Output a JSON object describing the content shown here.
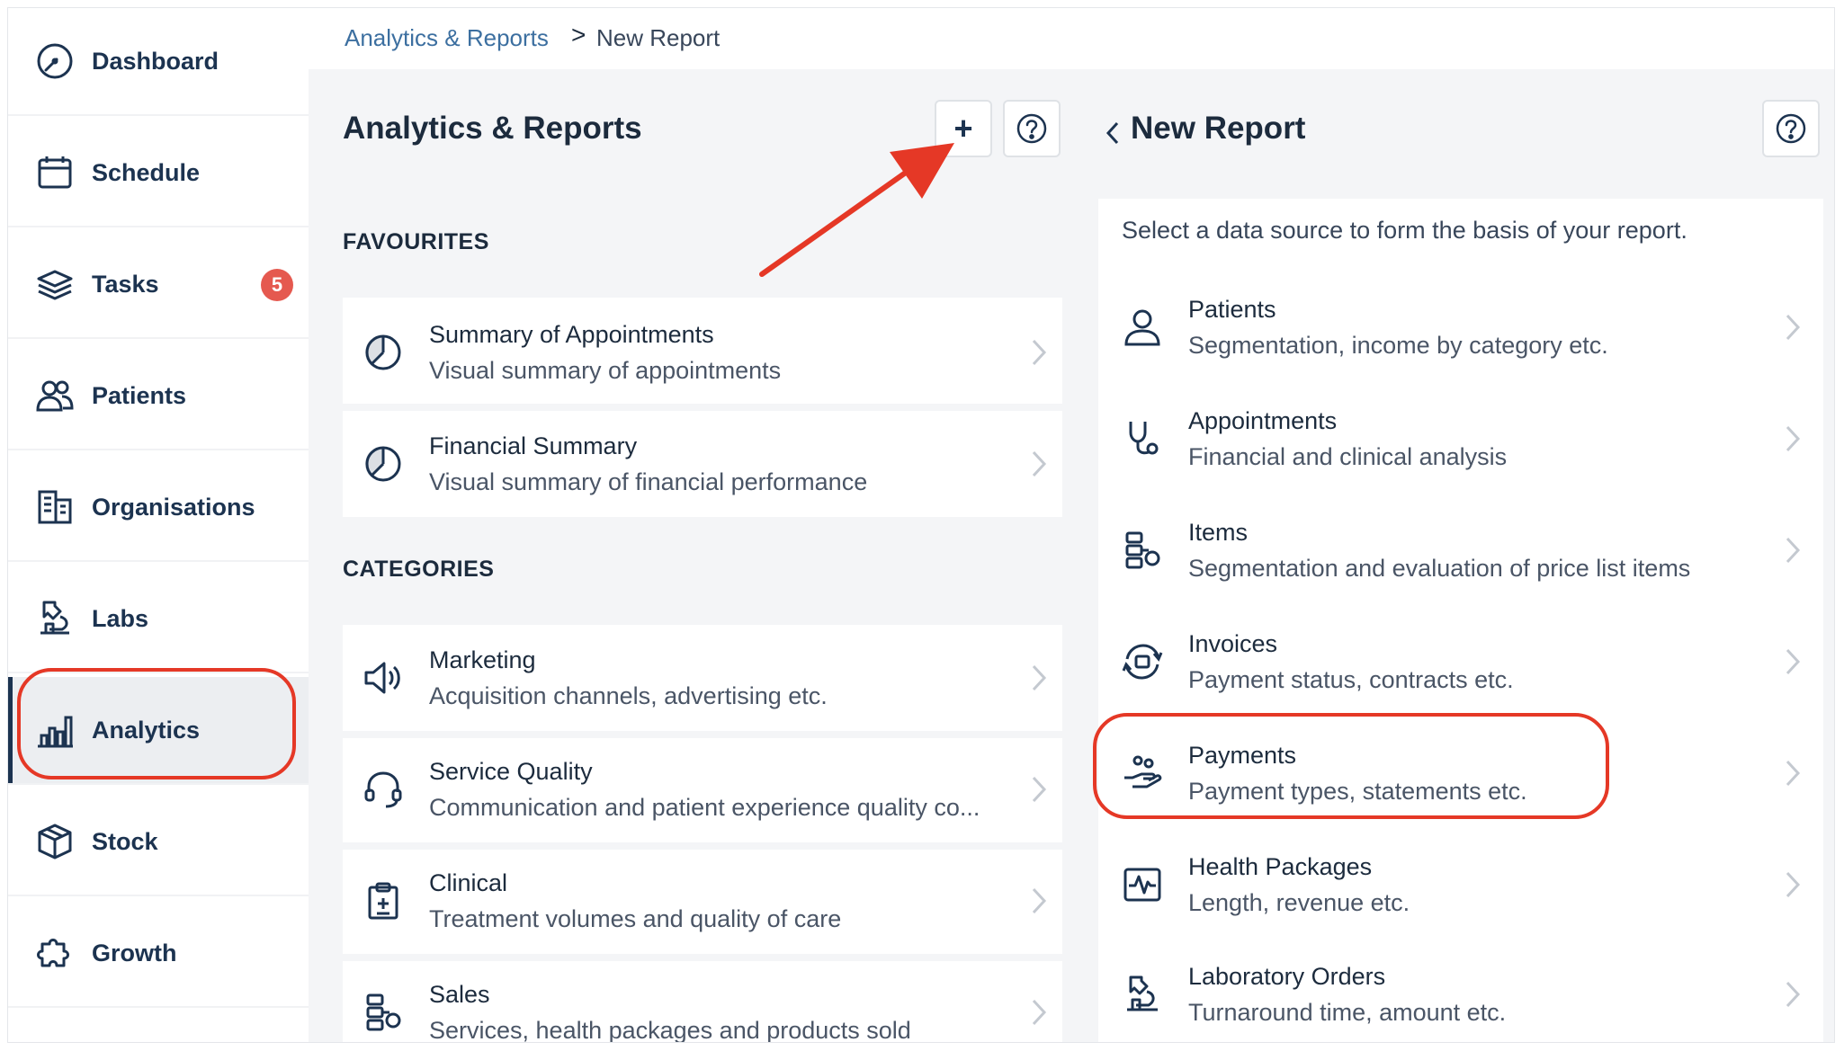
{
  "sidebar": {
    "items": [
      {
        "label": "Dashboard",
        "icon": "dashboard-gauge-icon"
      },
      {
        "label": "Schedule",
        "icon": "calendar-icon"
      },
      {
        "label": "Tasks",
        "icon": "layers-icon",
        "badge": "5"
      },
      {
        "label": "Patients",
        "icon": "users-icon"
      },
      {
        "label": "Organisations",
        "icon": "building-icon"
      },
      {
        "label": "Labs",
        "icon": "lab-icon"
      },
      {
        "label": "Analytics",
        "icon": "bar-chart-icon",
        "active": true
      },
      {
        "label": "Stock",
        "icon": "box-icon"
      },
      {
        "label": "Growth",
        "icon": "puzzle-icon"
      }
    ]
  },
  "breadcrumb": {
    "parent": "Analytics & Reports",
    "separator": ">",
    "current": "New Report"
  },
  "analytics": {
    "title": "Analytics & Reports",
    "add_label": "+",
    "favourites_label": "FAVOURITES",
    "favourites": [
      {
        "title": "Summary of Appointments",
        "subtitle": "Visual summary of appointments",
        "icon": "pie-chart-icon"
      },
      {
        "title": "Financial Summary",
        "subtitle": "Visual summary of financial performance",
        "icon": "pie-chart-icon"
      }
    ],
    "categories_label": "CATEGORIES",
    "categories": [
      {
        "title": "Marketing",
        "subtitle": "Acquisition channels, advertising etc.",
        "icon": "megaphone-icon"
      },
      {
        "title": "Service Quality",
        "subtitle": "Communication and patient experience quality co...",
        "icon": "headset-icon"
      },
      {
        "title": "Clinical",
        "subtitle": "Treatment volumes and quality of care",
        "icon": "clipboard-medical-icon"
      },
      {
        "title": "Sales",
        "subtitle": "Services, health packages and products sold",
        "icon": "items-icon"
      }
    ]
  },
  "new_report": {
    "title": "New Report",
    "back_icon": "chevron-left-icon",
    "hint": "Select a data source to form the basis of your report.",
    "sources": [
      {
        "title": "Patients",
        "subtitle": "Segmentation, income by category etc.",
        "icon": "person-icon"
      },
      {
        "title": "Appointments",
        "subtitle": "Financial and clinical analysis",
        "icon": "stethoscope-icon"
      },
      {
        "title": "Items",
        "subtitle": "Segmentation and evaluation of price list items",
        "icon": "items-icon"
      },
      {
        "title": "Invoices",
        "subtitle": "Payment status, contracts etc.",
        "icon": "invoice-cycle-icon"
      },
      {
        "title": "Payments",
        "subtitle": "Payment types, statements etc.",
        "icon": "hand-coins-icon"
      },
      {
        "title": "Health Packages",
        "subtitle": "Length, revenue etc.",
        "icon": "heartbeat-monitor-icon"
      },
      {
        "title": "Laboratory Orders",
        "subtitle": "Turnaround time, amount etc.",
        "icon": "lab-icon"
      }
    ]
  },
  "colors": {
    "accent": "#1c3350",
    "link": "#3c6fa0",
    "badge": "#e5594f",
    "annotation": "#e53826",
    "background": "#f4f5f7"
  }
}
